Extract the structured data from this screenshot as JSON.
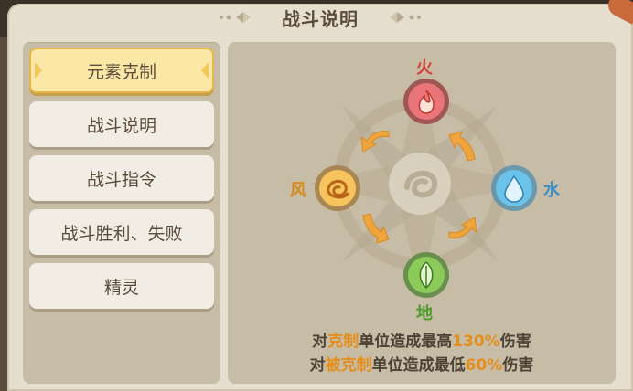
{
  "title": "战斗说明",
  "sidebar": {
    "items": [
      {
        "label": "元素克制",
        "active": true
      },
      {
        "label": "战斗说明",
        "active": false
      },
      {
        "label": "战斗指令",
        "active": false
      },
      {
        "label": "战斗胜利、失败",
        "active": false
      },
      {
        "label": "精灵",
        "active": false
      }
    ]
  },
  "elements": {
    "fire": {
      "label": "火",
      "color": "#d8413a",
      "icon": "fire-icon"
    },
    "water": {
      "label": "水",
      "color": "#3a8fc9",
      "icon": "water-drop-icon"
    },
    "earth": {
      "label": "地",
      "color": "#4f9a2c",
      "icon": "leaf-icon"
    },
    "wind": {
      "label": "风",
      "color": "#d68a1c",
      "icon": "swirl-icon"
    }
  },
  "info": {
    "line1": {
      "pre": "对",
      "hl1": "克制",
      "mid": "单位造成最高",
      "hl2": "130%",
      "post": "伤害"
    },
    "line2": {
      "pre": "对",
      "hl1": "被克制",
      "mid": "单位造成最低",
      "hl2": "60%",
      "post": "伤害"
    }
  },
  "colors": {
    "accent": "#e48f1c",
    "text": "#5b4b3a"
  }
}
